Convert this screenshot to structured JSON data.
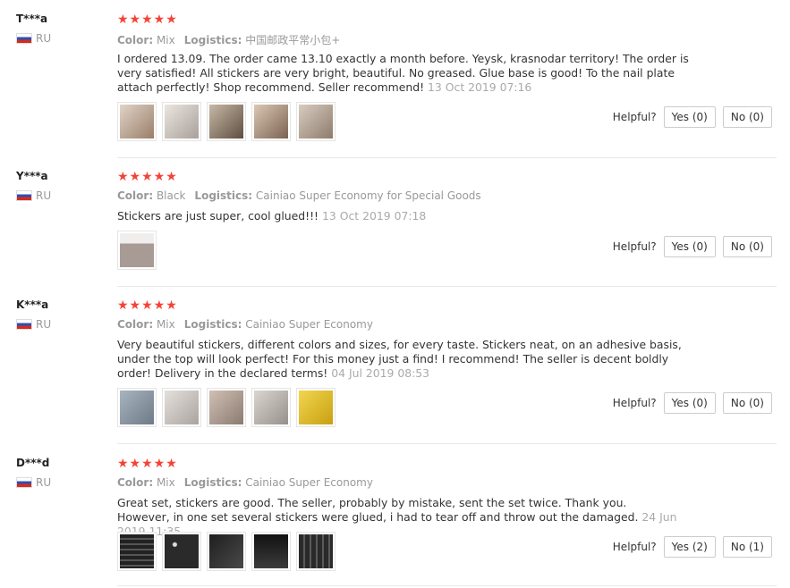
{
  "labels": {
    "color": "Color:",
    "logistics": "Logistics:",
    "helpful": "Helpful?",
    "stars": "★★★★★"
  },
  "reviews": [
    {
      "user": "T***a",
      "country": "RU",
      "color": "Mix",
      "logistics": "中国邮政平常小包+",
      "text": "I ordered 13.09. The order came 13.10 exactly a month before. Yeysk, krasnodar territory! The order is very satisfied! All stickers are very bright, beautiful. No greased. Glue base is good! To the nail plate attach perfectly! Shop recommend. Seller recommend!",
      "date": "13 Oct 2019 07:16",
      "yes": "Yes (0)",
      "no": "No (0)",
      "thumbs": [
        "#c9b8a8",
        "#d8d0c8",
        "#8a7a6a",
        "#b49a84",
        "#c0b0a0"
      ]
    },
    {
      "user": "Y***a",
      "country": "RU",
      "color": "Black",
      "logistics": "Cainiao Super Economy for Special Goods",
      "text": "Stickers are just super, cool glued!!!",
      "date": "13 Oct 2019 07:18",
      "yes": "Yes (0)",
      "no": "No (0)",
      "thumbs": [
        "#9a8e8a"
      ]
    },
    {
      "user": "K***a",
      "country": "RU",
      "color": "Mix",
      "logistics": "Cainiao Super Economy",
      "text": "Very beautiful stickers, different colors and sizes, for every taste. Stickers neat, on an adhesive basis, under the top will look perfect! For this money just a find! I recommend! The seller is decent boldly order! Delivery in the declared terms!",
      "date": "04 Jul 2019 08:53",
      "yes": "Yes (0)",
      "no": "No (0)",
      "thumbs": [
        "#8e9aa6",
        "#c8c4c0",
        "#a89a92",
        "#b0a8a4",
        "#e8c430"
      ]
    },
    {
      "user": "D***d",
      "country": "RU",
      "color": "Mix",
      "logistics": "Cainiao Super Economy",
      "text": "Great set, stickers are good. The seller, probably by mistake, sent the set twice. Thank you. However, in one set several stickers were glued, i had to tear off and throw out the damaged.",
      "date": "24 Jun 2019 11:35",
      "yes": "Yes (2)",
      "no": "No (1)",
      "thumbs": [
        "#2c2c2c",
        "#3a3a3a",
        "#262626",
        "#1e1e1e",
        "#333333"
      ]
    }
  ]
}
